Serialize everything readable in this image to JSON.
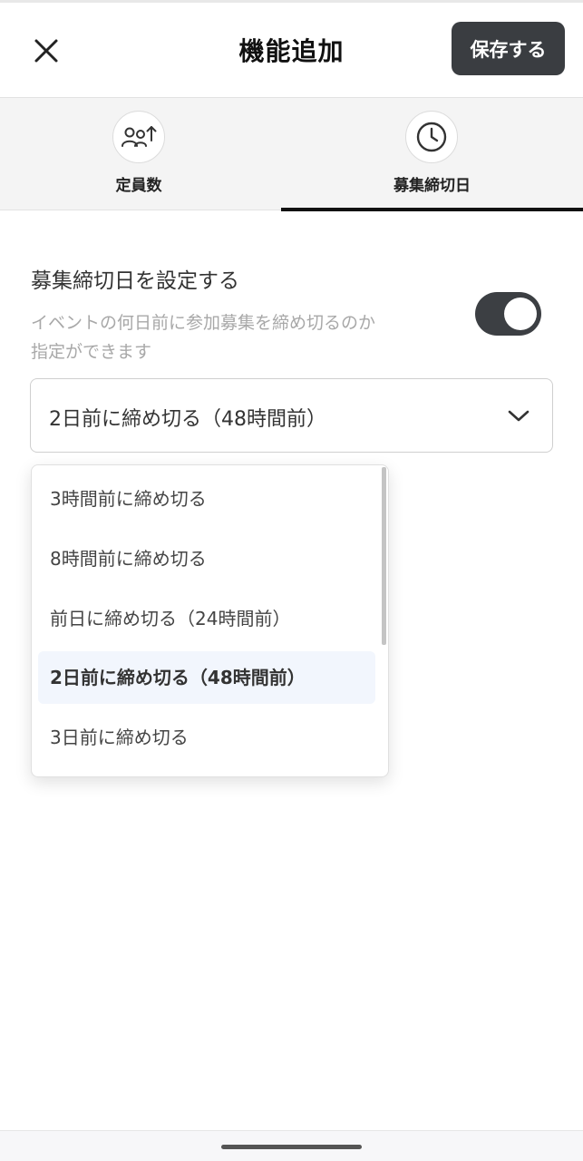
{
  "header": {
    "title": "機能追加",
    "save_label": "保存する",
    "close_icon": "close-icon"
  },
  "tabs": [
    {
      "label": "定員数",
      "icon": "people-up-icon",
      "active": false
    },
    {
      "label": "募集締切日",
      "icon": "clock-icon",
      "active": true
    }
  ],
  "setting": {
    "title": "募集締切日を設定する",
    "description_line1": "イベントの何日前に参加募集を締め切るのか",
    "description_line2": "指定ができます",
    "toggle_on": true
  },
  "select": {
    "value": "2日前に締め切る（48時間前）",
    "options": [
      "3時間前に締め切る",
      "8時間前に締め切る",
      "前日に締め切る（24時間前）",
      "2日前に締め切る（48時間前）",
      "3日前に締め切る"
    ],
    "selected_index": 3
  },
  "colors": {
    "primary_dark": "#3a3d41",
    "selected_option_bg": "#f2f6fd",
    "muted_text": "#a8a8a8"
  }
}
